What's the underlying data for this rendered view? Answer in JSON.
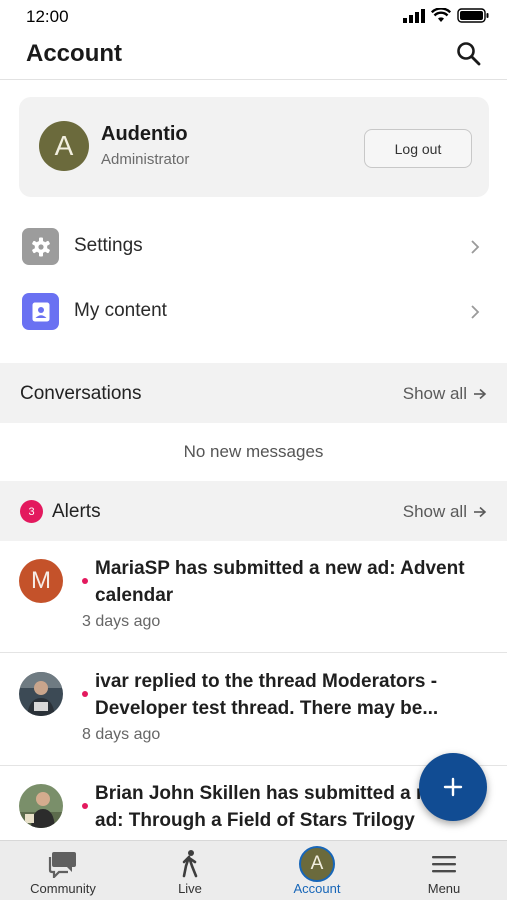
{
  "status_bar": {
    "time": "12:00",
    "icons": [
      "signal-icon",
      "wifi-icon",
      "battery-icon"
    ]
  },
  "header": {
    "title": "Account",
    "search_icon": "search-icon"
  },
  "profile": {
    "avatar_letter": "A",
    "name": "Audentio",
    "role": "Administrator",
    "logout_label": "Log out",
    "avatar_color": "#6b6a3c"
  },
  "menu": [
    {
      "label": "Settings",
      "icon": "gear-icon",
      "icon_color": "#9c9c9c"
    },
    {
      "label": "My content",
      "icon": "user-card-icon",
      "icon_color": "#6a71f2"
    }
  ],
  "conversations": {
    "title": "Conversations",
    "show_all": "Show all",
    "empty_text": "No new messages"
  },
  "alerts": {
    "title": "Alerts",
    "count": "3",
    "show_all": "Show all",
    "items": [
      {
        "avatar_type": "letter",
        "avatar_letter": "M",
        "avatar_color": "#c4522a",
        "text": "MariaSP has submitted a new ad: Advent calendar",
        "time": "3 days ago"
      },
      {
        "avatar_type": "photo",
        "text": "ivar replied to the thread Moderators - Developer test thread. There may be...",
        "time": "8 days ago"
      },
      {
        "avatar_type": "photo",
        "text": "Brian John Skillen has submitted a new ad: Through a Field of Stars Trilogy",
        "time": ""
      }
    ]
  },
  "fab": {
    "icon": "plus-icon",
    "color": "#114c93"
  },
  "tabs": [
    {
      "label": "Community",
      "icon": "chat-bubble-icon",
      "active": false
    },
    {
      "label": "Live",
      "icon": "walking-person-icon",
      "active": false
    },
    {
      "label": "Account",
      "icon": "avatar-icon",
      "avatar_letter": "A",
      "active": true
    },
    {
      "label": "Menu",
      "icon": "hamburger-icon",
      "active": false
    }
  ],
  "colors": {
    "accent": "#1766b8",
    "badge": "#e3195e",
    "section_bg": "#f2f2f2"
  }
}
